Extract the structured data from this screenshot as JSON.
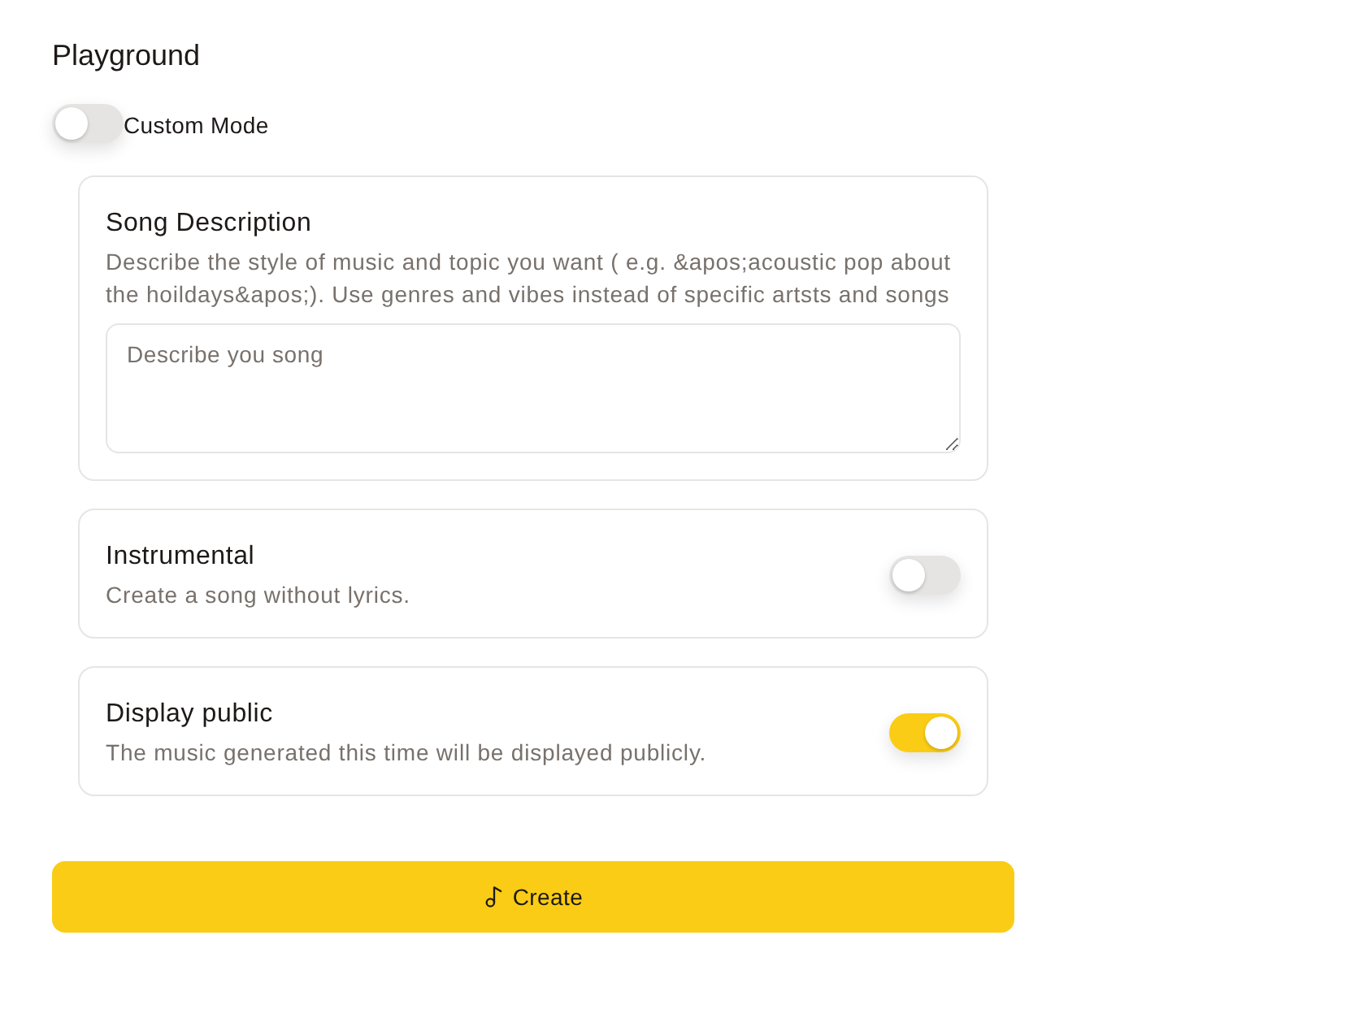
{
  "title": "Playground",
  "custom_mode": {
    "label": "Custom Mode",
    "on": false
  },
  "song_description": {
    "title": "Song Description",
    "description": "Describe the style of music and topic you want ( e.g. &apos;acoustic pop about the hoildays&apos;). Use genres and vibes instead of specific artsts and songs",
    "placeholder": "Describe you song"
  },
  "options": [
    {
      "title": "Instrumental",
      "description": "Create a song without lyrics.",
      "on": false
    },
    {
      "title": "Display public",
      "description": "The music generated this time will be displayed publicly.",
      "on": true
    }
  ],
  "create_button": {
    "label": "Create"
  }
}
